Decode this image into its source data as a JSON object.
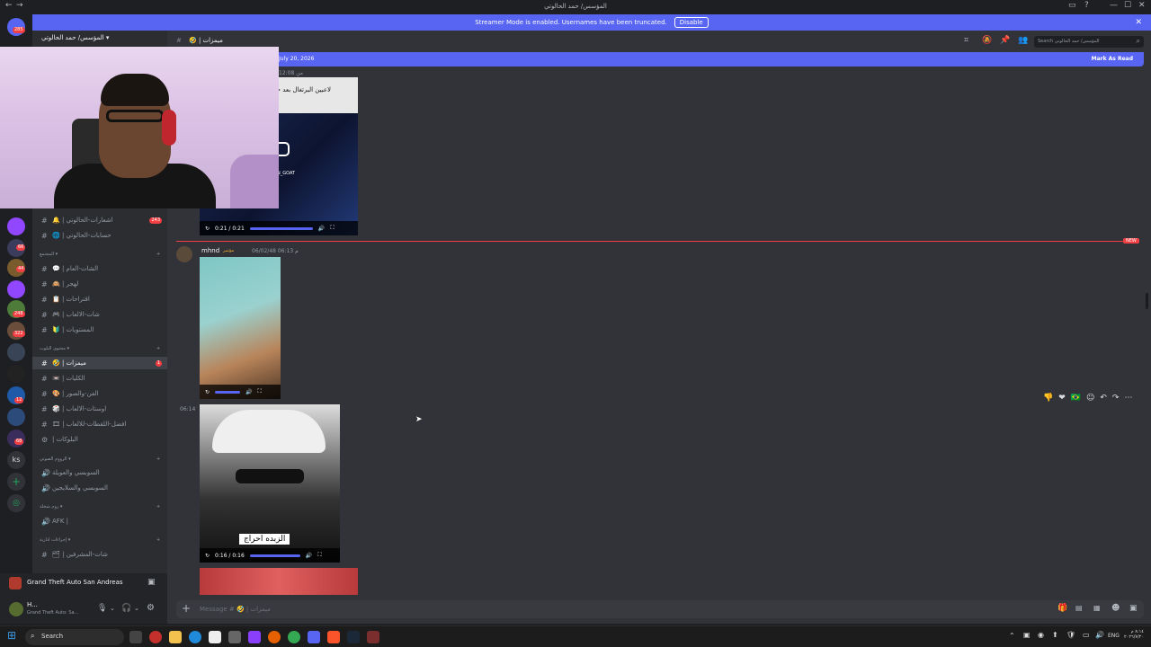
{
  "window": {
    "title": "المؤسس/ حمد الحالوتي",
    "min": "—",
    "max": "☐",
    "close": "✕"
  },
  "banner": {
    "text": "Streamer Mode is enabled. Usernames have been truncated.",
    "button": "Disable"
  },
  "server": {
    "name": "المؤسس/ حمد الحالوتي",
    "channel": "ميمزات",
    "unread_total": "285"
  },
  "header": {
    "search_placeholder": "Search المؤسس/ حمد الحالوتي"
  },
  "new_bar": {
    "date": "July 20, 2026",
    "action": "Mark As Read"
  },
  "servers": [
    {
      "badge": "285"
    },
    {
      "badge": ""
    },
    {
      "badge": "66"
    },
    {
      "badge": "44"
    },
    {
      "badge": ""
    },
    {
      "badge": "248"
    },
    {
      "badge": "322"
    },
    {
      "badge": ""
    },
    {
      "badge": ""
    },
    {
      "badge": "12"
    },
    {
      "badge": ""
    },
    {
      "badge": "68"
    }
  ],
  "channels": [
    {
      "name": "اشعارات-الحالوتي",
      "count": "243",
      "icon": "🔔"
    },
    {
      "name": "حسابات-الحالوتي",
      "count": "",
      "icon": "🌐"
    },
    {
      "name": "الشات-العام",
      "count": "",
      "icon": "💬"
    },
    {
      "name": "لهجر",
      "count": "",
      "icon": "🙉"
    },
    {
      "name": "اقتراحات",
      "count": "",
      "icon": "📋"
    },
    {
      "name": "شات-الالعاب",
      "count": "",
      "icon": "🎮"
    },
    {
      "name": "المستويات",
      "count": "",
      "icon": "🔰"
    },
    {
      "name": "ميمزات",
      "count": "1",
      "icon": "🤣"
    },
    {
      "name": "الكليات",
      "count": "",
      "icon": "📼"
    },
    {
      "name": "الفن-والصور",
      "count": "",
      "icon": "🎨"
    },
    {
      "name": "اوستات-الالعاب",
      "count": "",
      "icon": "🎲"
    },
    {
      "name": "افضل-اللقطات-للالعاب",
      "count": "",
      "icon": "🎞"
    },
    {
      "name": "البلوكات",
      "count": "",
      "icon": "⚙"
    }
  ],
  "categories": [
    "المجتمع",
    "محتوى البلوت",
    "الرووم الصوتي",
    "روم شخلة",
    "إجراءات ادارية"
  ],
  "voice": [
    "السوبسي والعويلة",
    "السوبسي والسلايجين",
    "AFK |"
  ],
  "admin_channel": {
    "name": "شات-المشرفين",
    "icon": "🗂"
  },
  "game_activity": "Grand Theft Auto San Andreas",
  "user": {
    "name": "H...",
    "status": "Grand Theft Auto: Sa..."
  },
  "messages": [
    {
      "time_top": "من 12:08",
      "video1": {
        "time": "0:21 / 0:21",
        "caption": "لاعبين البرتغال بعد جاي يلعبون",
        "handle": "N_GOAT"
      }
    },
    {
      "author": "mhnd",
      "tag": "مؤتمر",
      "timestamp": "06/02/48 06:13 م",
      "video_time": ""
    },
    {
      "time": "06:14",
      "video_time": "0:16 / 0:16",
      "caption": "الزبده احراج"
    }
  ],
  "new_label": "NEW",
  "composer": {
    "placeholder": "Message # 🤣 | ميمزات"
  },
  "taskbar": {
    "search": "Search",
    "lang": "ENG",
    "clock_time": "٨:١٤ م",
    "clock_date": "٢٠٢٦/٧/٢٠"
  }
}
